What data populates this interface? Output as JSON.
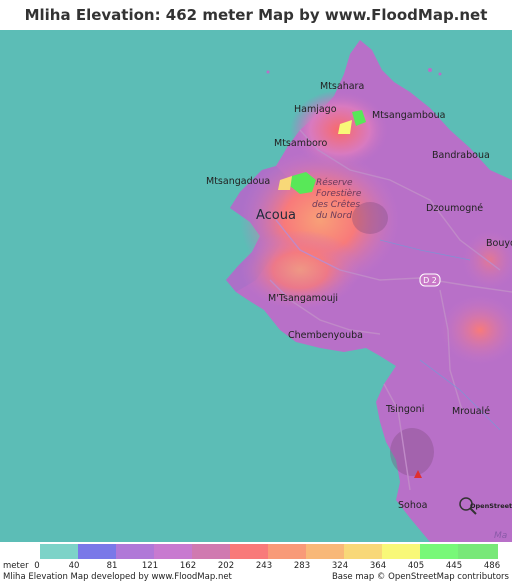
{
  "title": "Mliha Elevation: 462 meter Map by www.FloodMap.net (beta)",
  "map": {
    "places": [
      {
        "key": "mtsahara",
        "label": "Mtsahara"
      },
      {
        "key": "hamjago",
        "label": "Hamjago"
      },
      {
        "key": "mtsangamboua",
        "label": "Mtsangamboua"
      },
      {
        "key": "mtsamboro",
        "label": "Mtsamboro"
      },
      {
        "key": "bandraboua",
        "label": "Bandraboua"
      },
      {
        "key": "mtsangadoua",
        "label": "Mtsangadoua"
      },
      {
        "key": "acoua",
        "label": "Acoua"
      },
      {
        "key": "dzoumogne",
        "label": "Dzoumogné"
      },
      {
        "key": "bouyo",
        "label": "Bouyo"
      },
      {
        "key": "mtsangamouji",
        "label": "M'Tsangamouji"
      },
      {
        "key": "chembenyouba",
        "label": "Chembenyouba"
      },
      {
        "key": "tsingoni",
        "label": "Tsingoni"
      },
      {
        "key": "mroual",
        "label": "Mroualé"
      },
      {
        "key": "sohoa",
        "label": "Sohoa"
      }
    ],
    "reserve_lines": [
      "Réserve",
      "Forestière",
      "des Crêtes",
      "du Nord"
    ],
    "road_label": "D 2",
    "map_corner_text": "Ma",
    "osm_logo_text": "OpenStreetMap",
    "colors": {
      "sea": "#5cbdb6",
      "lowland": "#b870c8"
    }
  },
  "legend": {
    "unit_label": "meter",
    "ticks": [
      "0",
      "40",
      "81",
      "121",
      "162",
      "202",
      "243",
      "283",
      "324",
      "364",
      "405",
      "445",
      "486"
    ],
    "colors": [
      "#7dd3c8",
      "#7a78e8",
      "#b078d8",
      "#c87ad0",
      "#d07ab0",
      "#f87a7a",
      "#f89a78",
      "#f8b878",
      "#f8d878",
      "#f8f878",
      "#78f878",
      "#78e878"
    ],
    "footer_left": "Mliha Elevation Map developed by www.FloodMap.net",
    "footer_right": "Base map © OpenStreetMap contributors"
  }
}
